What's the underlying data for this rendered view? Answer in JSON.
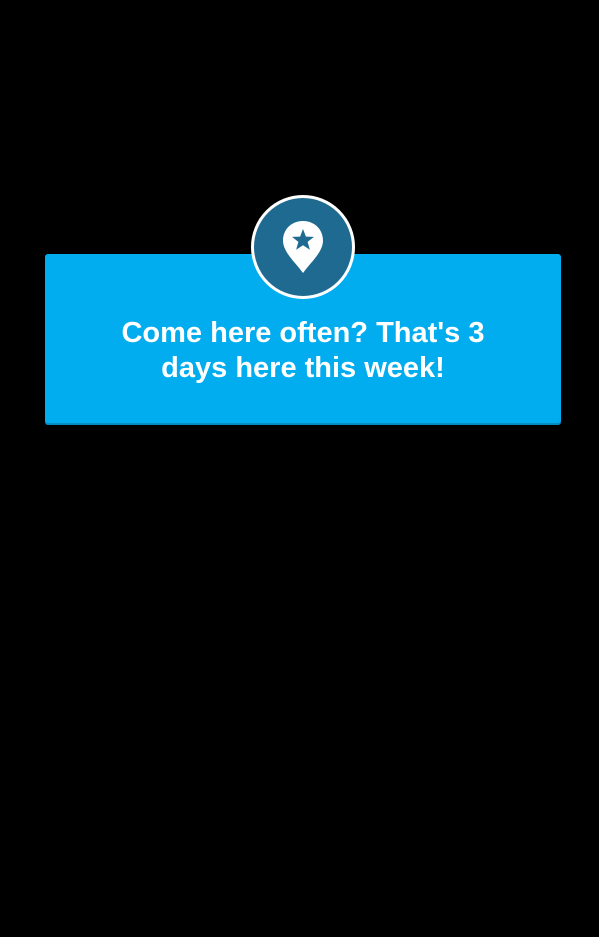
{
  "notification": {
    "message": "Come here often?  That's 3\ndays here this week!",
    "icon": "location-pin-star-icon"
  },
  "colors": {
    "background": "#000000",
    "banner": "#02adef",
    "badge": "#1f6a90",
    "text": "#ffffff"
  }
}
